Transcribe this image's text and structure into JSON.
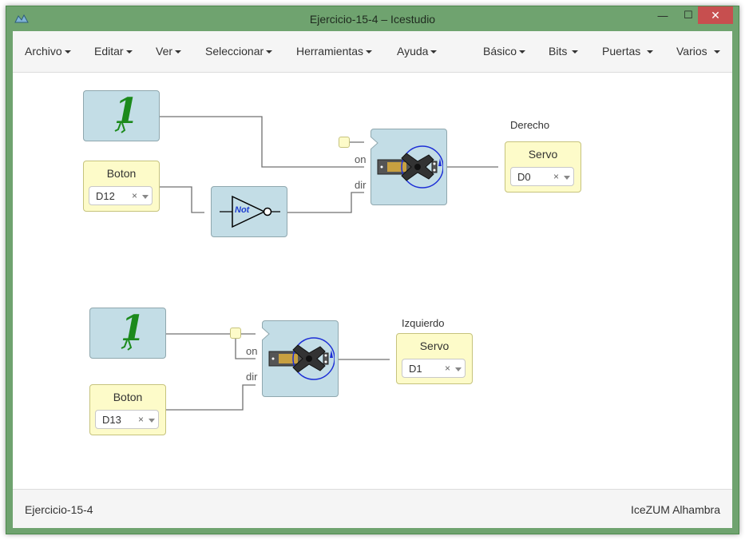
{
  "window": {
    "title": "Ejercicio-15-4 – Icestudio",
    "minimize_label": "—",
    "maximize_label": "☐",
    "close_label": "✕"
  },
  "menu": {
    "left": [
      {
        "label": "Archivo"
      },
      {
        "label": "Editar"
      },
      {
        "label": "Ver"
      },
      {
        "label": "Seleccionar"
      },
      {
        "label": "Herramientas"
      },
      {
        "label": "Ayuda"
      }
    ],
    "right": [
      {
        "label": "Básico"
      },
      {
        "label": "Bits"
      },
      {
        "label": "Puertas"
      },
      {
        "label": "Varios"
      }
    ]
  },
  "circuit": {
    "boton1": {
      "title": "Boton",
      "pin": "D12"
    },
    "boton2": {
      "title": "Boton",
      "pin": "D13"
    },
    "not_gate": {
      "label": "Not"
    },
    "servo1": {
      "caption": "Derecho",
      "title": "Servo",
      "pin": "D0"
    },
    "servo2": {
      "caption": "Izquierdo",
      "title": "Servo",
      "pin": "D1"
    },
    "ports": {
      "on": "on",
      "dir": "dir"
    },
    "select_clear": "×",
    "const_glyph": "1"
  },
  "footer": {
    "left": "Ejercicio-15-4",
    "right": "IceZUM Alhambra"
  },
  "colors": {
    "frame": "#6fa36f",
    "close": "#c74f4f",
    "block": "#c3dde6",
    "io_block": "#fdfbc9",
    "wire": "#707070"
  }
}
